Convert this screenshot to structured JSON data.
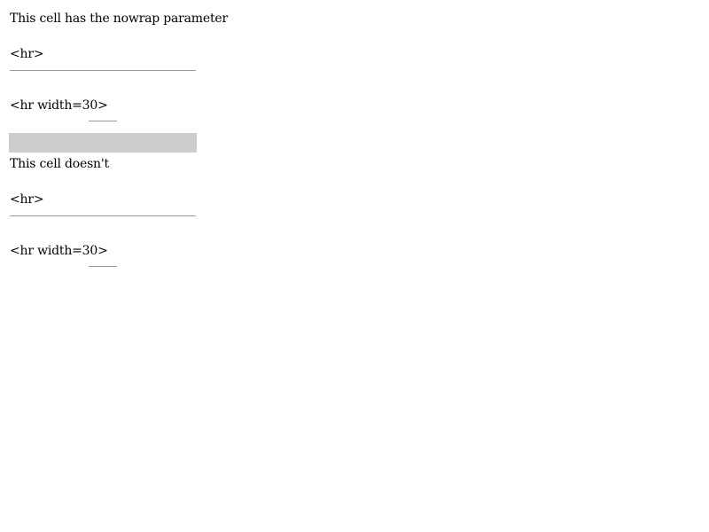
{
  "cell1": {
    "heading": "This cell has the nowrap parameter",
    "hr_label": "<hr>",
    "hr_width_label": "<hr width=30>"
  },
  "cell2": {
    "heading": "This cell doesn't",
    "hr_label": "<hr>",
    "hr_width_label": "<hr width=30>"
  },
  "colors": {
    "separator": "#cccccc",
    "rule": "#9a9a9a",
    "text": "#000000"
  }
}
